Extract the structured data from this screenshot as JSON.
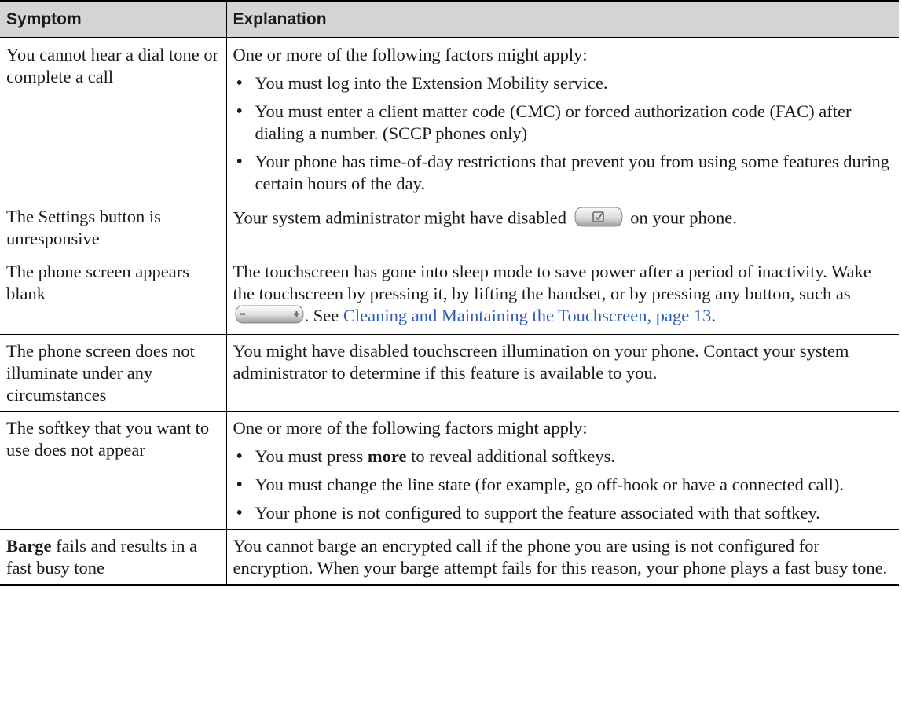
{
  "table": {
    "headers": {
      "symptom": "Symptom",
      "explanation": "Explanation"
    },
    "row1": {
      "symptom": "You cannot hear a dial tone or complete a call",
      "lead": "One or more of the following factors might apply:",
      "bullets": [
        "You must log into the Extension Mobility service.",
        "You must enter a client matter code (CMC) or forced authorization code (FAC) after dialing a number. (SCCP phones only)",
        "Your phone has time-of-day restrictions that prevent you from using some features during certain hours of the day."
      ]
    },
    "row2": {
      "symptom": "The Settings button is unresponsive",
      "before_icon": "Your system administrator might have disabled",
      "after_icon": "on your phone.",
      "icon": "settings-button-icon"
    },
    "row3": {
      "symptom": "The phone screen appears blank",
      "text_before": "The touchscreen has gone into sleep mode to save power after a period of inactivity. Wake the touchscreen by pressing it, by lifting the handset, or by pressing any button, such as",
      "icon": "volume-button-icon",
      "text_middle": ". See ",
      "link": "Cleaning and Maintaining the Touchscreen, page 13",
      "text_after": "."
    },
    "row4": {
      "symptom": "The phone screen does not illuminate under any circumstances",
      "explanation": "You might have disabled touchscreen illumination on your phone. Contact your system administrator to determine if this feature is available to you."
    },
    "row5": {
      "symptom": "The softkey that you want to use does not appear",
      "lead": "One or more of the following factors might apply:",
      "bullet1_before": "You must press ",
      "bullet1_key": "more",
      "bullet1_after": " to reveal additional softkeys.",
      "bullet2": "You must change the line state (for example, go off-hook or have a connected call).",
      "bullet3": "Your phone is not configured to support the feature associated with that softkey."
    },
    "row6": {
      "symptom_key": "Barge",
      "symptom_rest": " fails and results in a fast busy tone",
      "explanation": "You cannot barge an encrypted call if the phone you are using is not configured for encryption. When your barge attempt fails for this reason, your phone plays a fast busy tone."
    }
  }
}
